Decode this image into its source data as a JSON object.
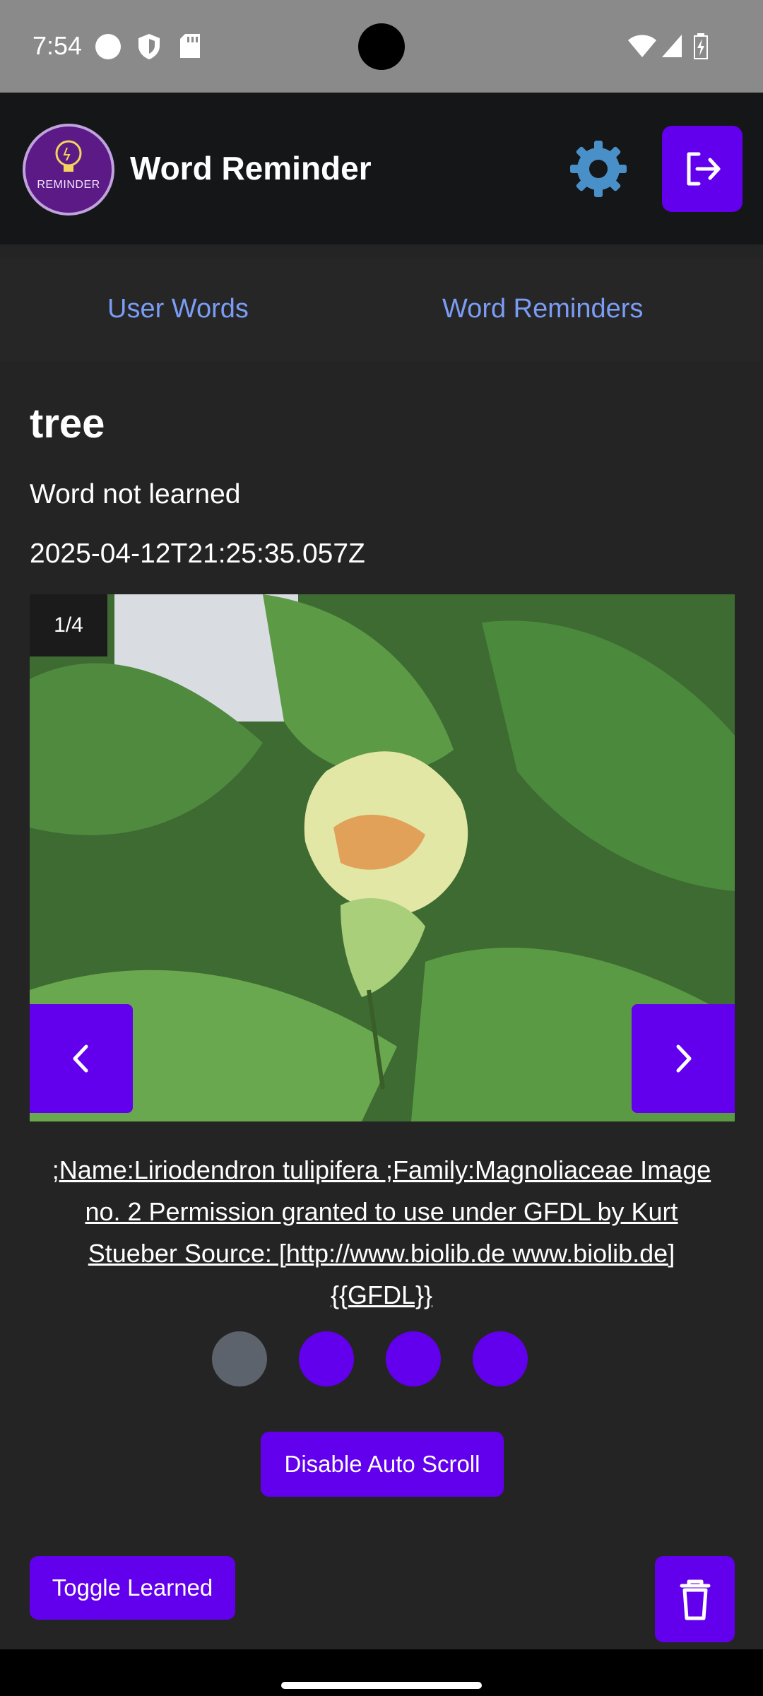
{
  "status_bar": {
    "time": "7:54"
  },
  "header": {
    "app_title": "Word Reminder",
    "logo_text": "REMINDER"
  },
  "tabs": [
    {
      "label": "User Words"
    },
    {
      "label": "Word Reminders"
    }
  ],
  "word": {
    "title": "tree",
    "status": "Word not learned",
    "date": "2025-04-12T21:25:35.057Z"
  },
  "carousel": {
    "counter": "1/4",
    "caption": ";Name:Liriodendron tulipifera ;Family:Magnoliaceae Image no. 2 Permission granted to use under GFDL by Kurt Stueber Source: [http://www.biolib.de www.biolib.de] {{GFDL}}",
    "current_slide": 1,
    "total_slides": 4
  },
  "dot_colors": {
    "active": "#5d636c",
    "inactive": "#6200ee"
  },
  "buttons": {
    "auto_scroll": "Disable Auto Scroll",
    "toggle_learned": "Toggle Learned"
  },
  "colors": {
    "accent": "#6200ee",
    "tab_text": "#7b9cf5",
    "background": "#242424",
    "header_bg": "#151618"
  }
}
